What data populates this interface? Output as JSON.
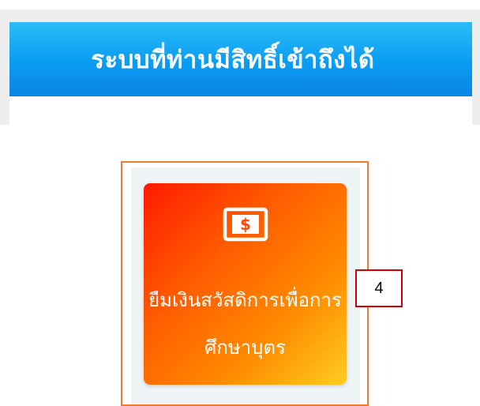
{
  "header": {
    "title": "ระบบที่ท่านมีสิทธิ์เข้าถึงได้"
  },
  "system_tile": {
    "icon": "dollar-bill-icon",
    "label": "ยืมเงินสวัสดิการเพื่อการศึกษาบุตร"
  },
  "annotation": {
    "number": "4"
  },
  "colors": {
    "banner_top": "#2bbdf7",
    "banner_bottom": "#0b84e6",
    "tile_start": "#ff1a00",
    "tile_end": "#ffcc22",
    "highlight_border": "#ee7d31",
    "annotation_border": "#cc0000"
  }
}
